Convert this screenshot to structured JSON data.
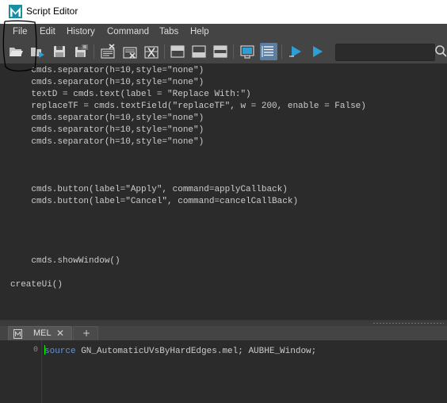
{
  "window": {
    "title": "Script Editor",
    "logo_icon": "maya-logo-icon"
  },
  "menu": [
    "File",
    "Edit",
    "History",
    "Command",
    "Tabs",
    "Help"
  ],
  "toolbar": {
    "search_placeholder": "",
    "buttons": [
      "open-script-icon",
      "source-script-icon",
      "save-script-icon",
      "save-script-to-shelf-icon",
      "clear-history-icon",
      "clear-input-icon",
      "clear-all-icon",
      "show-history-only-icon",
      "show-input-only-icon",
      "show-both-icon",
      "echo-all-commands-icon",
      "show-line-numbers-icon",
      "execute-all-icon",
      "execute-icon"
    ]
  },
  "code_lines": [
    "    cmds.separator(h=10,style=\"none\")",
    "    cmds.separator(h=10,style=\"none\")",
    "    textD = cmds.text(label = \"Replace With:\")",
    "    replaceTF = cmds.textField(\"replaceTF\", w = 200, enable = False)",
    "    cmds.separator(h=10,style=\"none\")",
    "    cmds.separator(h=10,style=\"none\")",
    "    cmds.separator(h=10,style=\"none\")",
    "",
    "",
    "",
    "    cmds.button(label=\"Apply\", command=applyCallback)",
    "    cmds.button(label=\"Cancel\", command=cancelCallBack)",
    "",
    "",
    "",
    "",
    "    cmds.showWindow()",
    "",
    "createUi()"
  ],
  "tabs": {
    "active_label": "MEL",
    "close_glyph": "✕",
    "add_glyph": "+"
  },
  "input": {
    "line_number": "0",
    "keyword": "source",
    "rest": " GN_AutomaticUVsByHardEdges.mel; AUBHE_Window;"
  },
  "colors": {
    "toolbar_active": "#5d7ea3",
    "play_icon": "#2e9fd6",
    "caret": "#00ff00",
    "keyword": "#5e95d8"
  }
}
